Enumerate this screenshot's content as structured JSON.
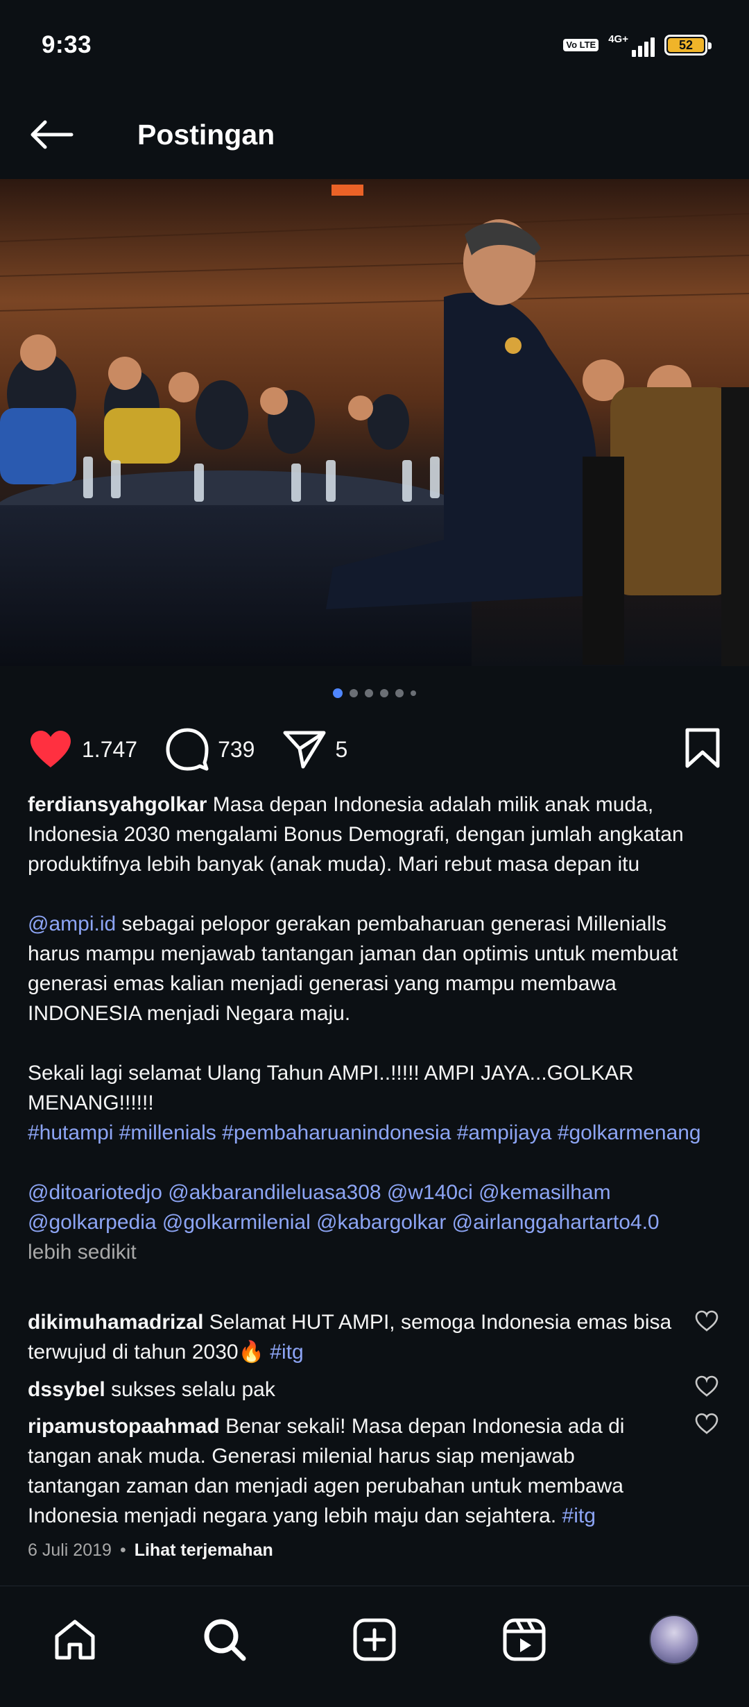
{
  "status_bar": {
    "time": "9:33",
    "network_label": "4G+",
    "volte_label": "Vo LTE",
    "battery": "52"
  },
  "header": {
    "title": "Postingan",
    "back_icon": "arrow-left-icon"
  },
  "carousel": {
    "count": 6,
    "active_index": 0
  },
  "actions": {
    "likes": "1.747",
    "comments": "739",
    "shares": "5",
    "like_color": "#ff3040"
  },
  "caption": {
    "username": "ferdiansyahgolkar",
    "para1": "Masa depan Indonesia adalah milik anak muda, Indonesia 2030 mengalami Bonus Demografi, dengan jumlah angkatan produktifnya lebih banyak (anak muda). Mari rebut masa depan itu",
    "mention1": "@ampi.id",
    "para2": "sebagai pelopor gerakan pembaharuan generasi Millenialls harus mampu menjawab tantangan jaman dan optimis untuk membuat generasi emas kalian menjadi generasi yang mampu membawa INDONESIA menjadi Negara maju.",
    "para3": "Sekali lagi selamat Ulang Tahun AMPI..!!!!! AMPI JAYA...GOLKAR MENANG!!!!!!",
    "hashtags": "#hutampi #millenials #pembaharuanindonesia #ampijaya #golkarmenang",
    "mentions": "@ditoariotedjo @akbarandileluasa308 @w140ci @kemasilham @golkarpedia @golkarmilenial @kabargolkar @airlanggahartarto4.0",
    "less_label": "lebih sedikit"
  },
  "comments": [
    {
      "username": "dikimuhamadrizal",
      "text": "Selamat HUT AMPI, semoga Indonesia emas bisa terwujud di tahun 2030🔥",
      "tag": "#itg"
    },
    {
      "username": "dssybel",
      "text": "sukses selalu pak",
      "tag": ""
    },
    {
      "username": "ripamustopaahmad",
      "text": "Benar sekali! Masa depan Indonesia ada di tangan anak muda. Generasi milenial harus siap menjawab tantangan zaman dan menjadi agen perubahan untuk membawa Indonesia menjadi negara yang lebih maju dan sejahtera.",
      "tag": "#itg"
    }
  ],
  "meta": {
    "date": "6 Juli 2019",
    "separator": "•",
    "translate": "Lihat terjemahan"
  },
  "nav": {
    "items": [
      "home-icon",
      "search-icon",
      "create-icon",
      "reels-icon",
      "profile-avatar"
    ]
  }
}
